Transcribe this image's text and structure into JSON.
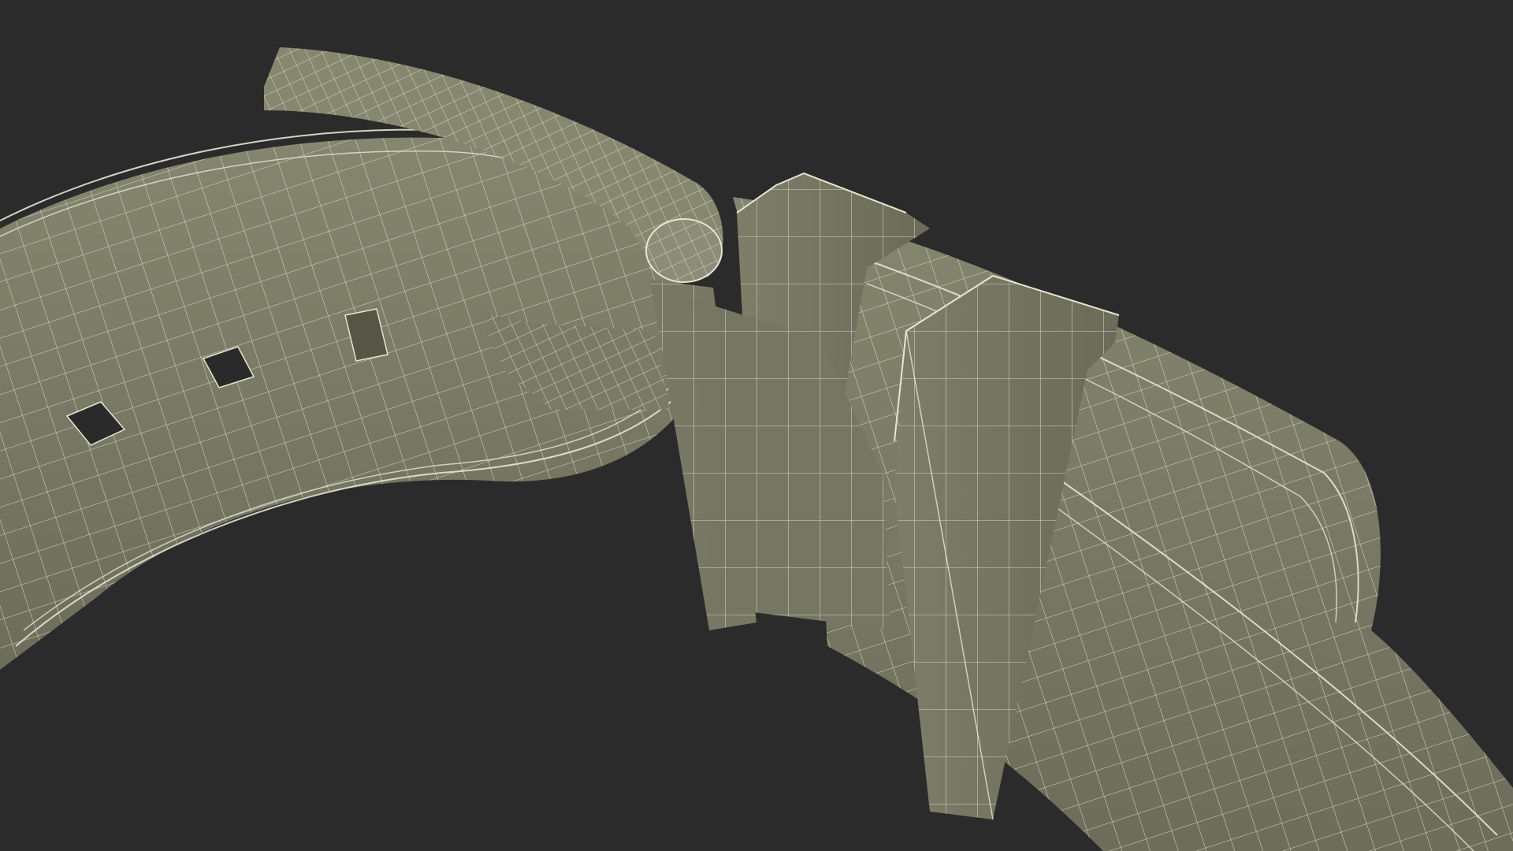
{
  "scene": {
    "subject": "belt-buckle-wireframe",
    "colors": {
      "background": "#2b2b2b",
      "surface": "#7b7c67",
      "surface_light": "#8a8b76",
      "surface_dark": "#5f604f",
      "wire": "#e6e6d4",
      "hole": "#2a2a2a"
    }
  }
}
